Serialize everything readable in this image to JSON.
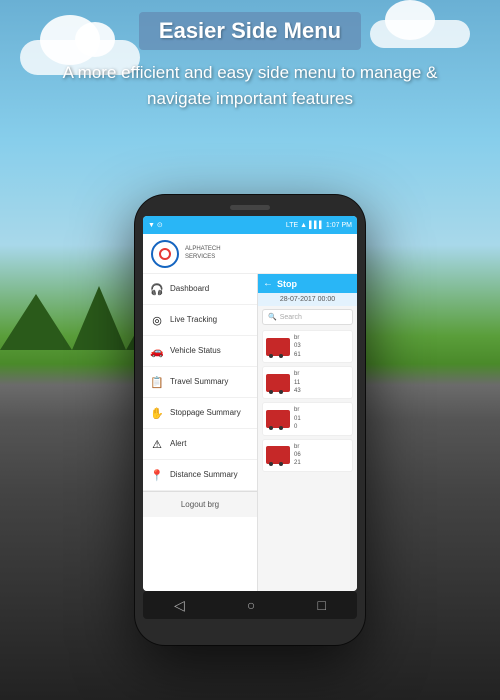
{
  "background": {
    "alt": "Road landscape background"
  },
  "header": {
    "title": "Easier Side Menu",
    "subtitle": "A more efficient and easy side menu to manage & navigate important features"
  },
  "phone": {
    "statusBar": {
      "left": "▼",
      "indicators": "⊙ ⊙ LTE ▲▼",
      "time": "1:07 PM",
      "signal": "▌▌▌"
    },
    "appLogo": {
      "name": "ALPHATECH",
      "sub": "SERVICES"
    },
    "rightPanel": {
      "title": "Stop",
      "date": "28-07-2017  00:00",
      "searchPlaceholder": "Search"
    },
    "menuItems": [
      {
        "label": "Dashboard",
        "icon": "🎧"
      },
      {
        "label": "Live Tracking",
        "icon": "◎"
      },
      {
        "label": "Vehicle Status",
        "icon": "🚗"
      },
      {
        "label": "Travel Summary",
        "icon": "📊"
      },
      {
        "label": "Stoppage Summary",
        "icon": "✋"
      },
      {
        "label": "Alert",
        "icon": "⚠"
      },
      {
        "label": "Distance Summary",
        "icon": "📍"
      }
    ],
    "logoutLabel": "Logout brg",
    "busItems": [
      {
        "code": "br",
        "details": "03\n61"
      },
      {
        "code": "br",
        "details": "11\n43"
      },
      {
        "code": "br",
        "details": "01\n0"
      },
      {
        "code": "br",
        "details": "06\n21"
      }
    ],
    "bottomNav": [
      "◁",
      "○",
      "□"
    ]
  }
}
